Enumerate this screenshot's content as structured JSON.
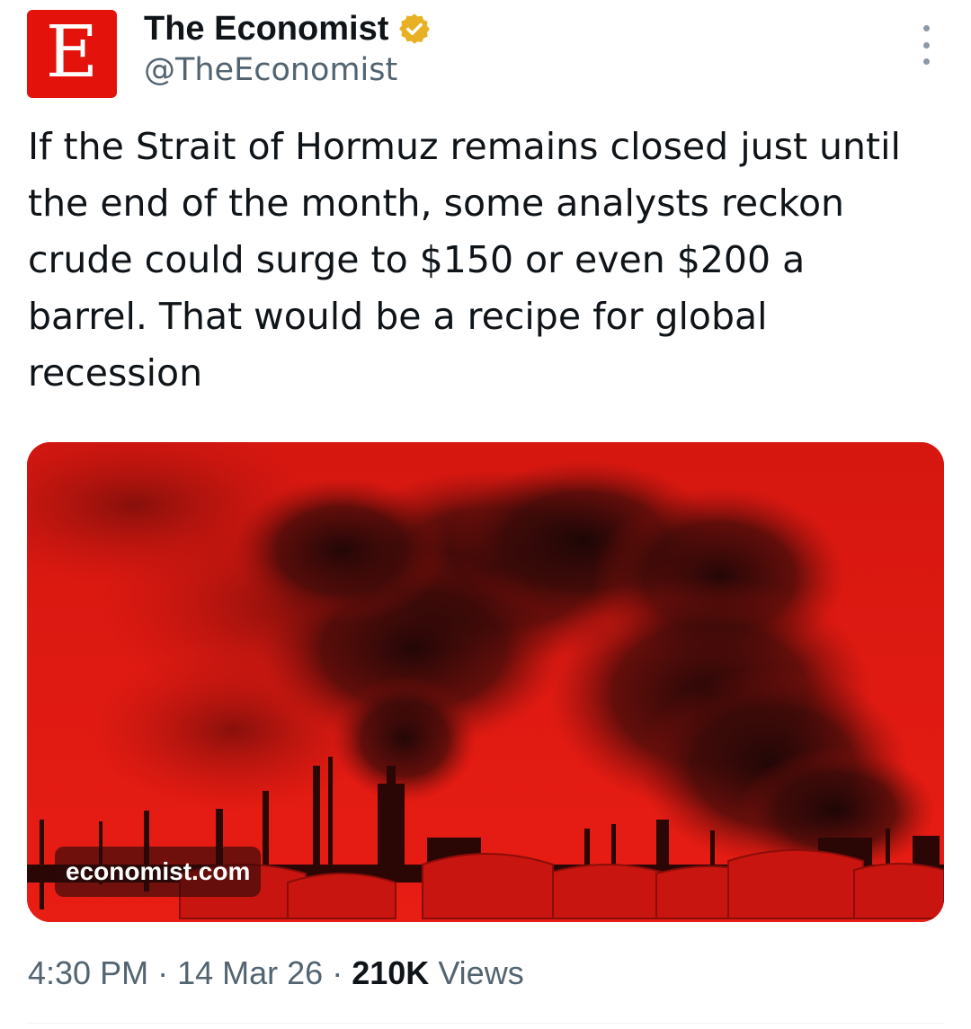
{
  "author": {
    "avatar_letter": "E",
    "avatar_color": "#e3120b",
    "display_name": "The Economist",
    "handle": "@TheEconomist",
    "verified_badge_color": "#e8b123"
  },
  "tweet": {
    "text": "If the Strait of Hormuz remains closed just until the end of the month, some analysts reckon crude could surge to $150 or even $200 a barrel. That would be a recipe for global recession"
  },
  "media": {
    "link_label": "economist.com",
    "tint_color": "#e01a12"
  },
  "meta": {
    "time": "4:30 PM",
    "separator": "·",
    "date": "14 Mar 26",
    "views_count": "210K",
    "views_label": "Views"
  },
  "icons": {
    "more": "more-vertical-icon",
    "verified": "verified-badge-icon"
  }
}
